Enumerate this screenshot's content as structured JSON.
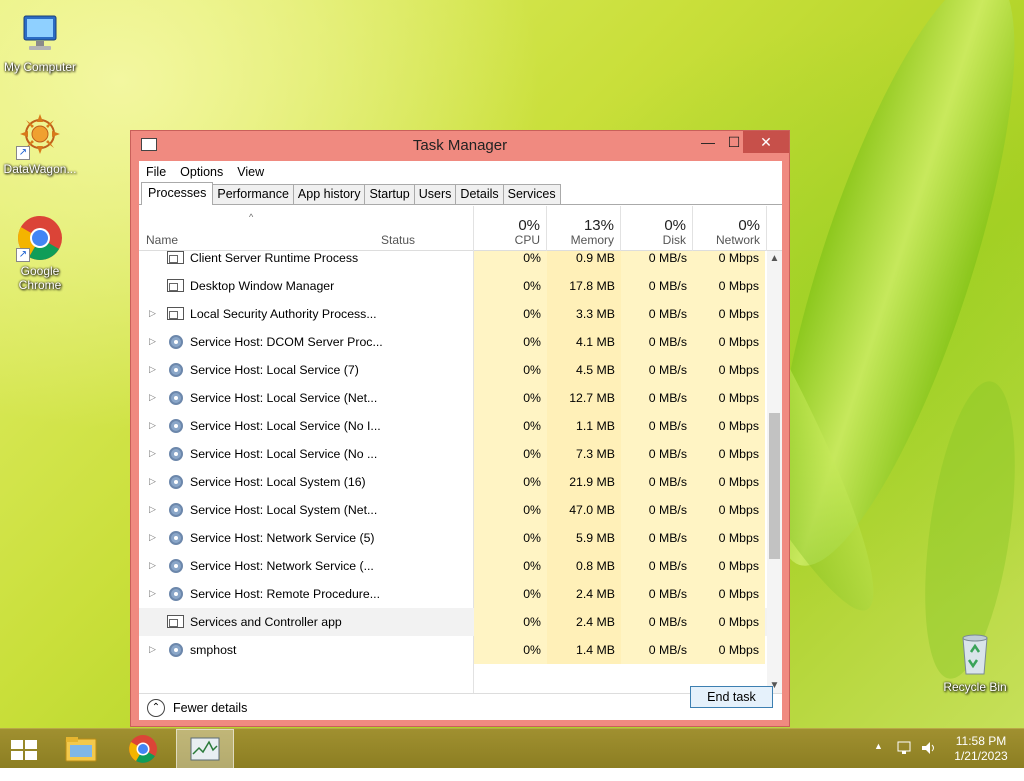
{
  "desktop": {
    "icons": [
      {
        "label": "My Computer",
        "icon": "computer-icon"
      },
      {
        "label": "DataWagon...",
        "icon": "datawagon-icon"
      },
      {
        "label": "Google Chrome",
        "icon": "chrome-icon"
      },
      {
        "label": "Recycle Bin",
        "icon": "recycle-bin-icon"
      }
    ]
  },
  "window": {
    "title": "Task Manager",
    "controls": {
      "minimize": "—",
      "maximize": "☐",
      "close": "✕"
    },
    "menu": [
      "File",
      "Options",
      "View"
    ],
    "tabs": [
      "Processes",
      "Performance",
      "App history",
      "Startup",
      "Users",
      "Details",
      "Services"
    ],
    "active_tab": "Processes",
    "columns": {
      "name": "Name",
      "status": "Status",
      "cpu": {
        "label": "CPU",
        "pct": "0%"
      },
      "memory": {
        "label": "Memory",
        "pct": "13%"
      },
      "disk": {
        "label": "Disk",
        "pct": "0%"
      },
      "network": {
        "label": "Network",
        "pct": "0%"
      }
    },
    "rows": [
      {
        "name": "Client Server Runtime Process",
        "expandable": false,
        "icon": "window",
        "cpu": "0%",
        "memory": "0.9 MB",
        "disk": "0 MB/s",
        "network": "0 Mbps"
      },
      {
        "name": "Desktop Window Manager",
        "expandable": false,
        "icon": "window",
        "cpu": "0%",
        "memory": "17.8 MB",
        "disk": "0 MB/s",
        "network": "0 Mbps"
      },
      {
        "name": "Local Security Authority Process...",
        "expandable": true,
        "icon": "window",
        "cpu": "0%",
        "memory": "3.3 MB",
        "disk": "0 MB/s",
        "network": "0 Mbps"
      },
      {
        "name": "Service Host: DCOM Server Proc...",
        "expandable": true,
        "icon": "gear",
        "cpu": "0%",
        "memory": "4.1 MB",
        "disk": "0 MB/s",
        "network": "0 Mbps"
      },
      {
        "name": "Service Host: Local Service (7)",
        "expandable": true,
        "icon": "gear",
        "cpu": "0%",
        "memory": "4.5 MB",
        "disk": "0 MB/s",
        "network": "0 Mbps"
      },
      {
        "name": "Service Host: Local Service (Net...",
        "expandable": true,
        "icon": "gear",
        "cpu": "0%",
        "memory": "12.7 MB",
        "disk": "0 MB/s",
        "network": "0 Mbps"
      },
      {
        "name": "Service Host: Local Service (No I...",
        "expandable": true,
        "icon": "gear",
        "cpu": "0%",
        "memory": "1.1 MB",
        "disk": "0 MB/s",
        "network": "0 Mbps"
      },
      {
        "name": "Service Host: Local Service (No ...",
        "expandable": true,
        "icon": "gear",
        "cpu": "0%",
        "memory": "7.3 MB",
        "disk": "0 MB/s",
        "network": "0 Mbps"
      },
      {
        "name": "Service Host: Local System (16)",
        "expandable": true,
        "icon": "gear",
        "cpu": "0%",
        "memory": "21.9 MB",
        "disk": "0 MB/s",
        "network": "0 Mbps"
      },
      {
        "name": "Service Host: Local System (Net...",
        "expandable": true,
        "icon": "gear",
        "cpu": "0%",
        "memory": "47.0 MB",
        "disk": "0 MB/s",
        "network": "0 Mbps"
      },
      {
        "name": "Service Host: Network Service (5)",
        "expandable": true,
        "icon": "gear",
        "cpu": "0%",
        "memory": "5.9 MB",
        "disk": "0 MB/s",
        "network": "0 Mbps"
      },
      {
        "name": "Service Host: Network Service (...",
        "expandable": true,
        "icon": "gear",
        "cpu": "0%",
        "memory": "0.8 MB",
        "disk": "0 MB/s",
        "network": "0 Mbps"
      },
      {
        "name": "Service Host: Remote Procedure...",
        "expandable": true,
        "icon": "gear",
        "cpu": "0%",
        "memory": "2.4 MB",
        "disk": "0 MB/s",
        "network": "0 Mbps"
      },
      {
        "name": "Services and Controller app",
        "expandable": false,
        "icon": "window",
        "cpu": "0%",
        "memory": "2.4 MB",
        "disk": "0 MB/s",
        "network": "0 Mbps",
        "highlighted": true
      },
      {
        "name": "smphost",
        "expandable": true,
        "icon": "gear",
        "cpu": "0%",
        "memory": "1.4 MB",
        "disk": "0 MB/s",
        "network": "0 Mbps"
      }
    ],
    "footer": {
      "fewer_details": "Fewer details",
      "end_task": "End task"
    }
  },
  "taskbar": {
    "pinned": [
      "start-icon",
      "file-explorer-icon",
      "chrome-icon",
      "task-manager-icon"
    ],
    "clock": {
      "time": "11:58 PM",
      "date": "1/21/2023"
    },
    "tray": [
      "show-hidden-icons",
      "network-icon",
      "volume-icon"
    ]
  },
  "colors": {
    "window_frame": "#f08a80",
    "close_button": "#c7504a",
    "cpu_heat": "#fff4c4",
    "memory_heat": "#fff0b8",
    "taskbar": "#958628"
  }
}
